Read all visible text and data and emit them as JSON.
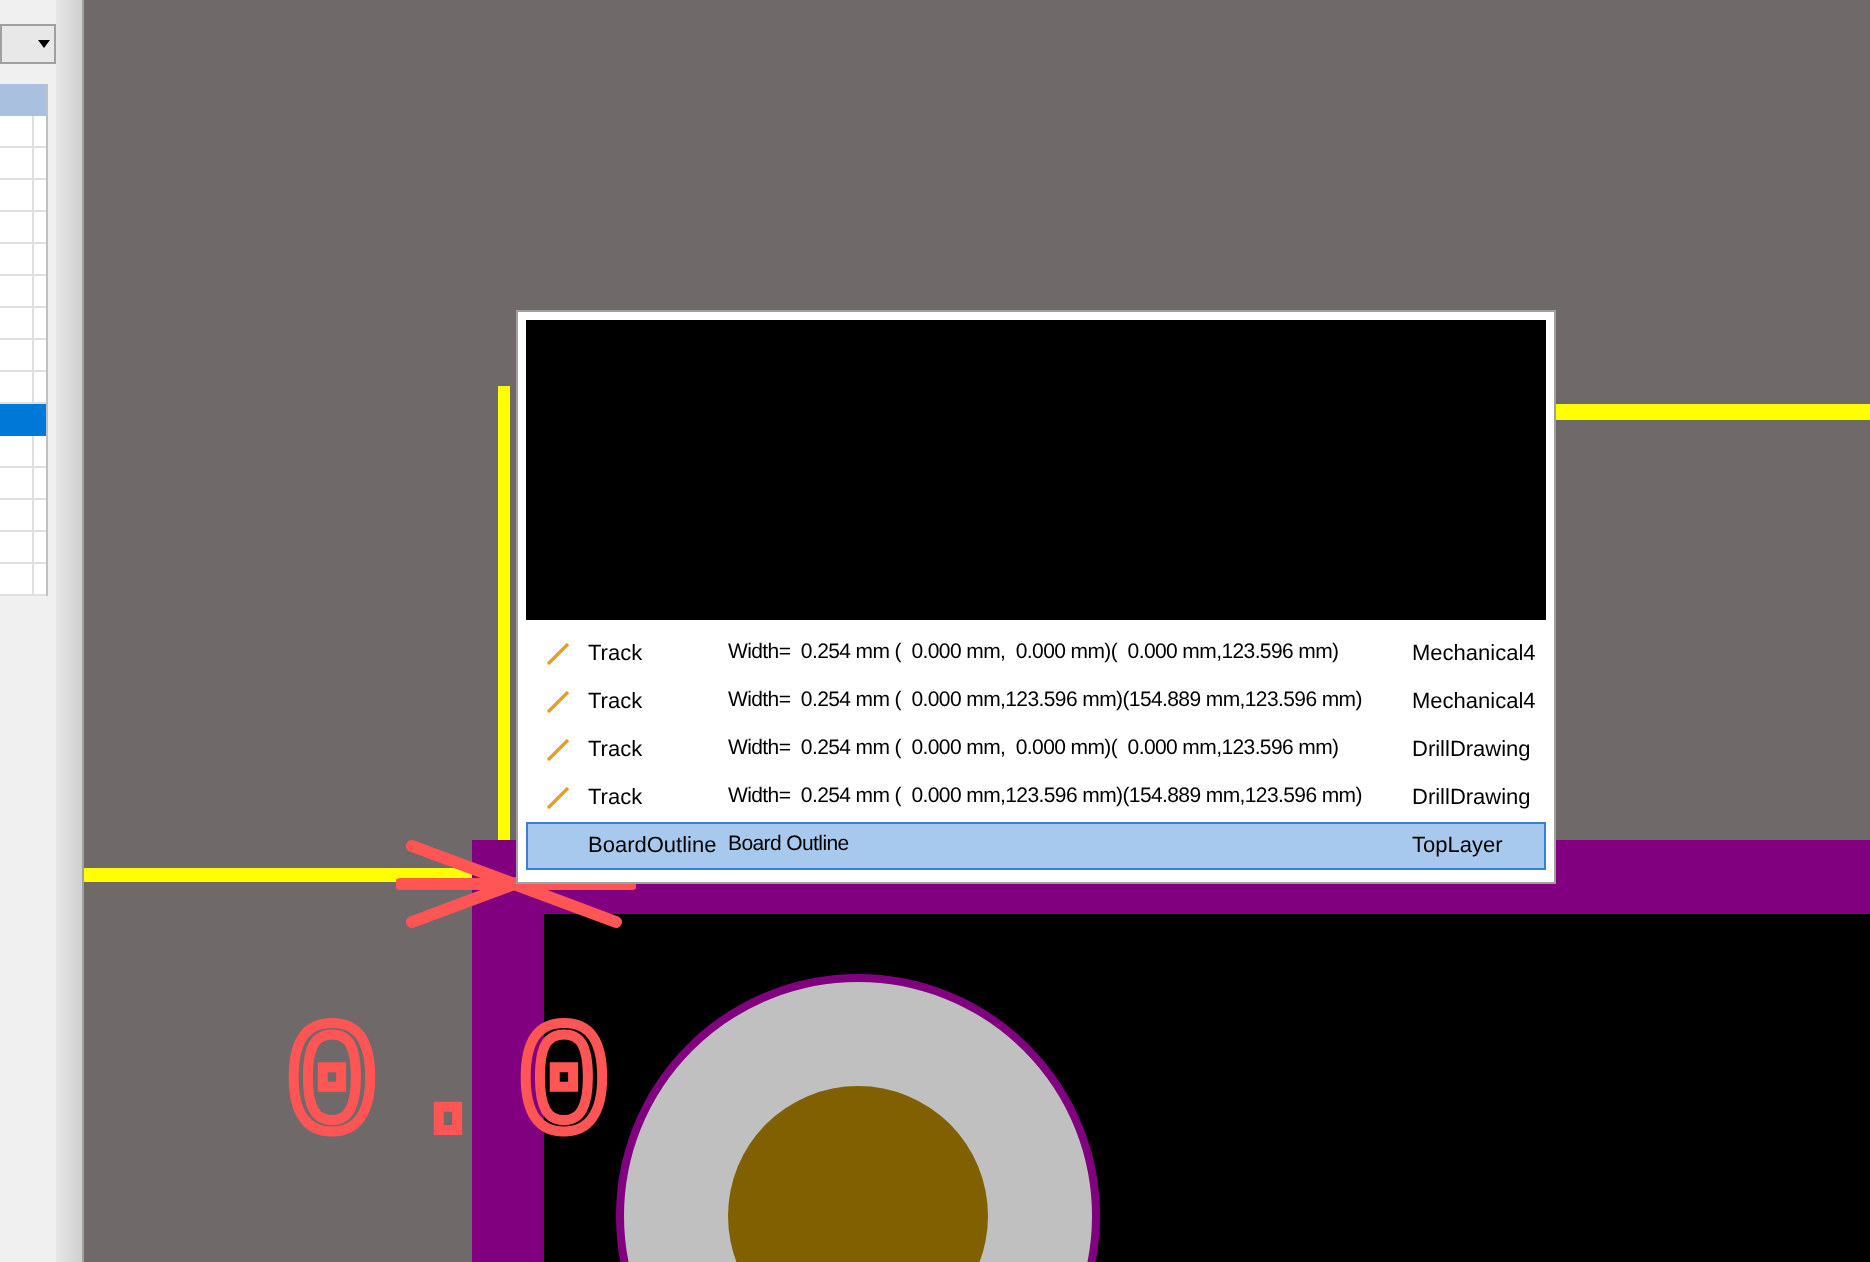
{
  "side_panel": {
    "rows": [
      {
        "selected": false
      },
      {
        "selected": false
      },
      {
        "selected": false
      },
      {
        "selected": false
      },
      {
        "selected": false
      },
      {
        "selected": false
      },
      {
        "selected": false
      },
      {
        "selected": false
      },
      {
        "selected": false
      },
      {
        "selected": true
      },
      {
        "selected": false
      },
      {
        "selected": false
      },
      {
        "selected": false
      },
      {
        "selected": false
      },
      {
        "selected": false
      }
    ]
  },
  "canvas": {
    "designator_text": "0.0"
  },
  "popup": {
    "items": [
      {
        "kind": "track",
        "type": "Track",
        "description": "Width=  0.254 mm (  0.000 mm,  0.000 mm)(  0.000 mm,123.596 mm)",
        "layer": "Mechanical4",
        "selected": false
      },
      {
        "kind": "track",
        "type": "Track",
        "description": "Width=  0.254 mm (  0.000 mm,123.596 mm)(154.889 mm,123.596 mm)",
        "layer": "Mechanical4",
        "selected": false
      },
      {
        "kind": "track",
        "type": "Track",
        "description": "Width=  0.254 mm (  0.000 mm,  0.000 mm)(  0.000 mm,123.596 mm)",
        "layer": "DrillDrawing",
        "selected": false
      },
      {
        "kind": "track",
        "type": "Track",
        "description": "Width=  0.254 mm (  0.000 mm,123.596 mm)(154.889 mm,123.596 mm)",
        "layer": "DrillDrawing",
        "selected": false
      },
      {
        "kind": "outline",
        "type": "BoardOutline",
        "description": "Board Outline",
        "layer": "TopLayer",
        "selected": true
      }
    ]
  }
}
